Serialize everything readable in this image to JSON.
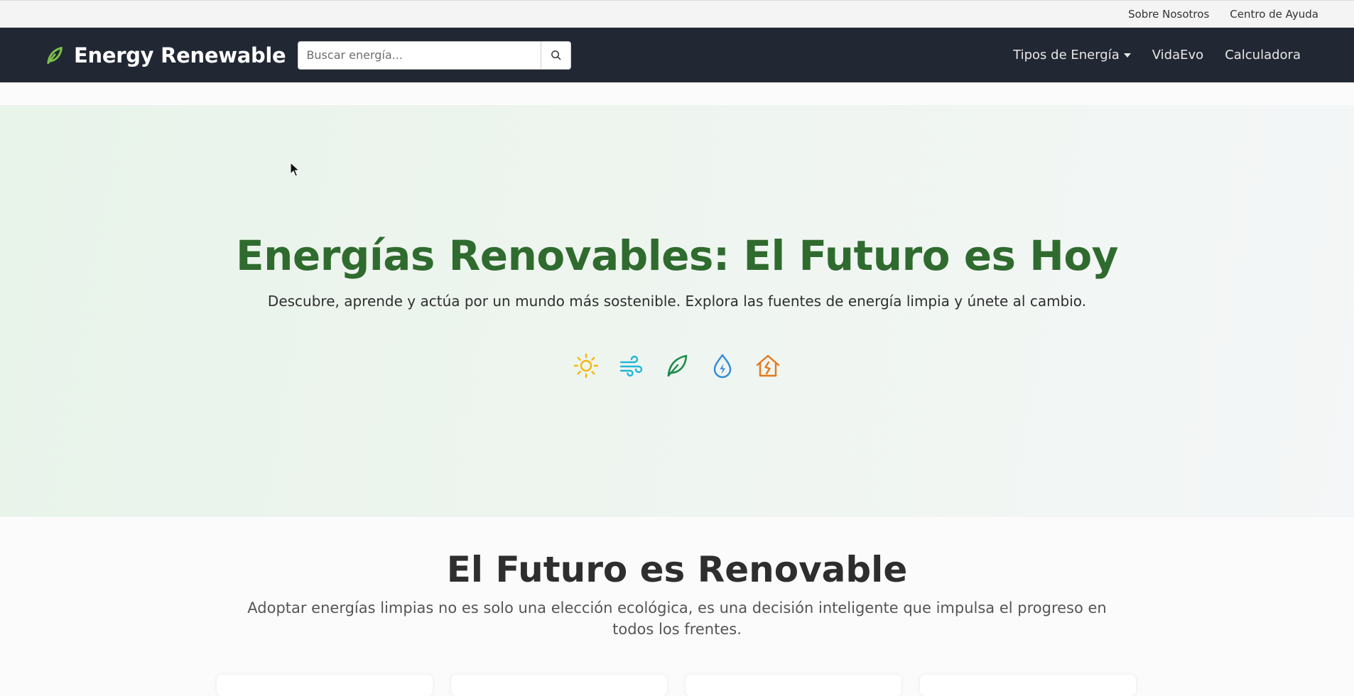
{
  "topbar": {
    "links": [
      "Sobre Nosotros",
      "Centro de Ayuda"
    ]
  },
  "navbar": {
    "brand": "Energy Renewable",
    "brand_icon": "leaf-icon",
    "search_placeholder": "Buscar energía...",
    "search_icon": "search-icon",
    "links": [
      "Tipos de Energía",
      "VidaEvo",
      "Calculadora"
    ]
  },
  "hero": {
    "title": "Energías Renovables: El Futuro es Hoy",
    "subtitle": "Descubre, aprende y actúa por un mundo más sostenible. Explora las fuentes de energía limpia y únete al cambio.",
    "icons": [
      {
        "name": "sun-icon",
        "color": "#f5b50c"
      },
      {
        "name": "wind-icon",
        "color": "#1fb6d8"
      },
      {
        "name": "leaf-icon",
        "color": "#1e8a4c"
      },
      {
        "name": "water-energy-icon",
        "color": "#2f8ad8"
      },
      {
        "name": "geothermal-house-icon",
        "color": "#e3781e"
      }
    ]
  },
  "section": {
    "title": "El Futuro es Renovable",
    "text": "Adoptar energías limpias no es solo una elección ecológica, es una decisión inteligente que impulsa el progreso en todos los frentes."
  },
  "colors": {
    "navbar_bg": "#212733",
    "hero_title": "#2f6b2e",
    "brand_leaf": "#7bbf4a"
  }
}
